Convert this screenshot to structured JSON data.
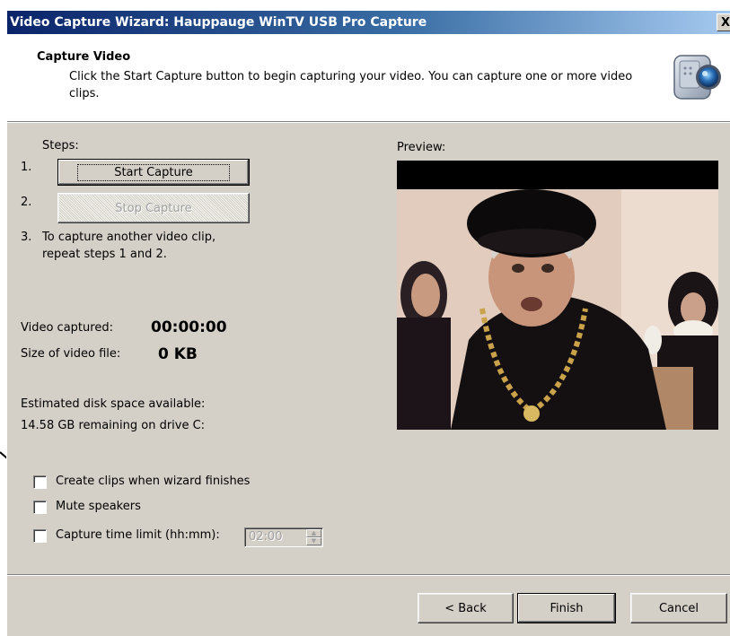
{
  "window": {
    "title": "Video Capture Wizard: Hauppauge WinTV USB Pro Capture",
    "close_glyph": "X"
  },
  "header": {
    "title": "Capture Video",
    "description": "Click the Start Capture button to begin capturing your video. You can capture one or more video clips.",
    "icon": "video-camera-icon"
  },
  "steps": {
    "heading": "Steps:",
    "step1_num": "1.",
    "step2_num": "2.",
    "step3_num": "3.",
    "start_capture_label": "Start Capture",
    "stop_capture_label": "Stop Capture",
    "step3_line1": "To capture another video clip,",
    "step3_line2": "repeat steps 1 and 2."
  },
  "stats": {
    "video_captured_label": "Video captured:",
    "video_captured_value": "00:00:00",
    "file_size_label": "Size of video file:",
    "file_size_value": "0 KB",
    "disk_space_label": "Estimated disk space available:",
    "disk_space_value": "14.58 GB remaining on drive C:"
  },
  "preview": {
    "label": "Preview:"
  },
  "options": {
    "create_clips_label": "Create clips when wizard finishes",
    "create_clips_checked": false,
    "mute_label": "Mute speakers",
    "mute_checked": false,
    "time_limit_label": "Capture time limit (hh:mm):",
    "time_limit_checked": false,
    "time_limit_value": "02:00"
  },
  "footer": {
    "back_label": "< Back",
    "finish_label": "Finish",
    "cancel_label": "Cancel"
  }
}
